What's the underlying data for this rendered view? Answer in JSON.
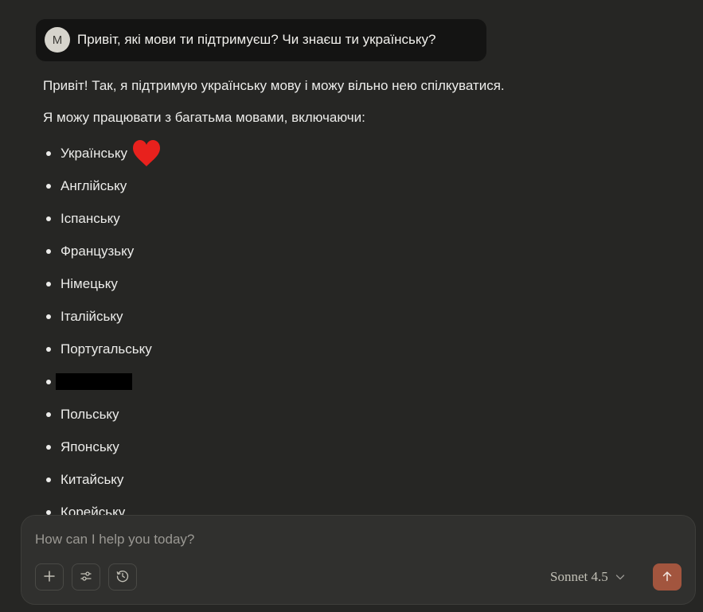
{
  "user_message": {
    "avatar_initial": "M",
    "text": "Привіт, які мови ти підтримуєш? Чи знаєш ти українську?"
  },
  "assistant_reply": {
    "paragraph_1": "Привіт! Так, я підтримую українську мову і можу вільно нею спілкуватися.",
    "paragraph_2": "Я можу працювати з багатьма мовами, включаючи:",
    "languages": [
      "Українську",
      "Англійську",
      "Іспанську",
      "Французьку",
      "Німецьку",
      "Італійську",
      "Португальську",
      "",
      "Польську",
      "Японську",
      "Китайську",
      "Корейську"
    ],
    "heart_icon": "red-heart-icon",
    "heart_color": "#e8211d"
  },
  "composer": {
    "placeholder": "How can I help you today?",
    "model_label": "Sonnet 4.5",
    "send_color": "#a2553e"
  },
  "icons": {
    "add": "plus-icon",
    "settings": "sliders-icon",
    "history": "clock-icon",
    "model_dropdown": "chevron-down-icon",
    "send": "arrow-up-icon"
  }
}
